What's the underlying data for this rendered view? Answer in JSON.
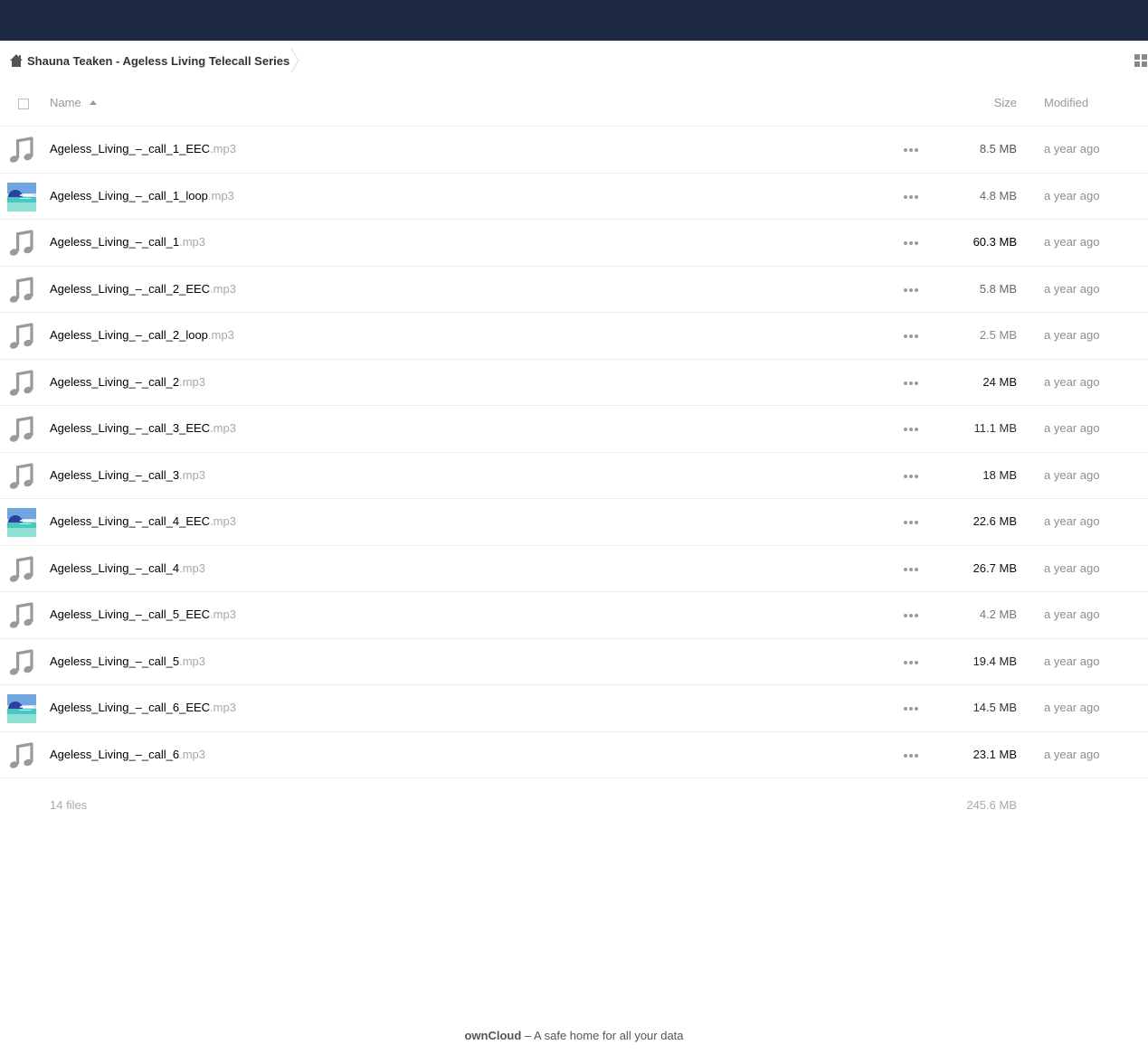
{
  "header": {
    "bg_color": "#1d2a42"
  },
  "breadcrumb": {
    "home_icon": "home-icon",
    "folder": "Shauna Teaken - Ageless Living Telecall Series"
  },
  "table": {
    "col_name": "Name",
    "col_size": "Size",
    "col_modified": "Modified",
    "sort": "name-ascending"
  },
  "files": [
    {
      "base": "Ageless_Living_–_call_1_EEC",
      "ext": ".mp3",
      "size": "8.5 MB",
      "modified": "a year ago",
      "icon": "music-note-icon",
      "size_color": "#555555"
    },
    {
      "base": "Ageless_Living_–_call_1_loop",
      "ext": ".mp3",
      "size": "4.8 MB",
      "modified": "a year ago",
      "icon": "album-art-thumbnail",
      "size_color": "#666666"
    },
    {
      "base": "Ageless_Living_–_call_1",
      "ext": ".mp3",
      "size": "60.3 MB",
      "modified": "a year ago",
      "icon": "music-note-icon",
      "size_color": "#000000"
    },
    {
      "base": "Ageless_Living_–_call_2_EEC",
      "ext": ".mp3",
      "size": "5.8 MB",
      "modified": "a year ago",
      "icon": "music-note-icon",
      "size_color": "#666666"
    },
    {
      "base": "Ageless_Living_–_call_2_loop",
      "ext": ".mp3",
      "size": "2.5 MB",
      "modified": "a year ago",
      "icon": "music-note-icon",
      "size_color": "#888888"
    },
    {
      "base": "Ageless_Living_–_call_2",
      "ext": ".mp3",
      "size": "24 MB",
      "modified": "a year ago",
      "icon": "music-note-icon",
      "size_color": "#111111"
    },
    {
      "base": "Ageless_Living_–_call_3_EEC",
      "ext": ".mp3",
      "size": "11.1 MB",
      "modified": "a year ago",
      "icon": "music-note-icon",
      "size_color": "#333333"
    },
    {
      "base": "Ageless_Living_–_call_3",
      "ext": ".mp3",
      "size": "18 MB",
      "modified": "a year ago",
      "icon": "music-note-icon",
      "size_color": "#222222"
    },
    {
      "base": "Ageless_Living_–_call_4_EEC",
      "ext": ".mp3",
      "size": "22.6 MB",
      "modified": "a year ago",
      "icon": "album-art-thumbnail",
      "size_color": "#111111"
    },
    {
      "base": "Ageless_Living_–_call_4",
      "ext": ".mp3",
      "size": "26.7 MB",
      "modified": "a year ago",
      "icon": "music-note-icon",
      "size_color": "#111111"
    },
    {
      "base": "Ageless_Living_–_call_5_EEC",
      "ext": ".mp3",
      "size": "4.2 MB",
      "modified": "a year ago",
      "icon": "music-note-icon",
      "size_color": "#777777"
    },
    {
      "base": "Ageless_Living_–_call_5",
      "ext": ".mp3",
      "size": "19.4 MB",
      "modified": "a year ago",
      "icon": "music-note-icon",
      "size_color": "#222222"
    },
    {
      "base": "Ageless_Living_–_call_6_EEC",
      "ext": ".mp3",
      "size": "14.5 MB",
      "modified": "a year ago",
      "icon": "album-art-thumbnail",
      "size_color": "#333333"
    },
    {
      "base": "Ageless_Living_–_call_6",
      "ext": ".mp3",
      "size": "23.1 MB",
      "modified": "a year ago",
      "icon": "music-note-icon",
      "size_color": "#111111"
    }
  ],
  "summary": {
    "files": "14 files",
    "total_size": "245.6 MB"
  },
  "footer": {
    "brand": "ownCloud",
    "tagline": " – A safe home for all your data"
  },
  "colors": {
    "icon_gray": "#9a9a9a",
    "muted_text": "#a8a8a8"
  }
}
